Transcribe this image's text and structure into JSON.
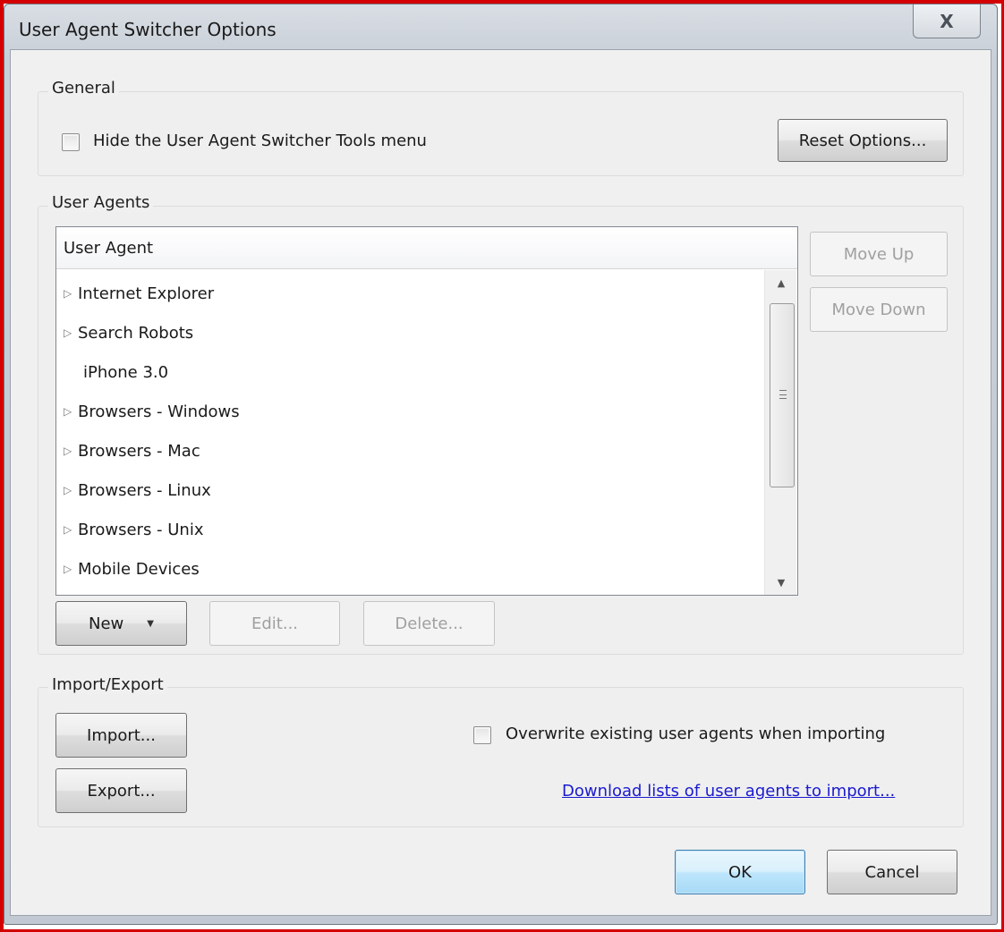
{
  "window": {
    "title": "User Agent Switcher Options",
    "close_label": "X"
  },
  "general": {
    "label": "General",
    "hide_tools_menu_label": "Hide the User Agent Switcher Tools menu",
    "hide_tools_menu_checked": false,
    "reset_button": "Reset Options..."
  },
  "user_agents": {
    "label": "User Agents",
    "column_header": "User Agent",
    "items": [
      {
        "label": "Internet Explorer",
        "expandable": true
      },
      {
        "label": "Search Robots",
        "expandable": true
      },
      {
        "label": "iPhone 3.0",
        "expandable": false
      },
      {
        "label": "Browsers - Windows",
        "expandable": true
      },
      {
        "label": "Browsers - Mac",
        "expandable": true
      },
      {
        "label": "Browsers - Linux",
        "expandable": true
      },
      {
        "label": "Browsers - Unix",
        "expandable": true
      },
      {
        "label": "Mobile Devices",
        "expandable": true
      }
    ],
    "move_up_button": "Move Up",
    "move_down_button": "Move Down",
    "new_button": "New",
    "edit_button": "Edit...",
    "delete_button": "Delete..."
  },
  "import_export": {
    "label": "Import/Export",
    "import_button": "Import...",
    "export_button": "Export...",
    "overwrite_label": "Overwrite existing user agents when importing",
    "overwrite_checked": false,
    "download_link": "Download lists of user agents to import..."
  },
  "footer": {
    "ok_button": "OK",
    "cancel_button": "Cancel"
  },
  "colors": {
    "frame": "#d40000",
    "link": "#1a1ad0",
    "default_button_border": "#3c7fb1"
  }
}
